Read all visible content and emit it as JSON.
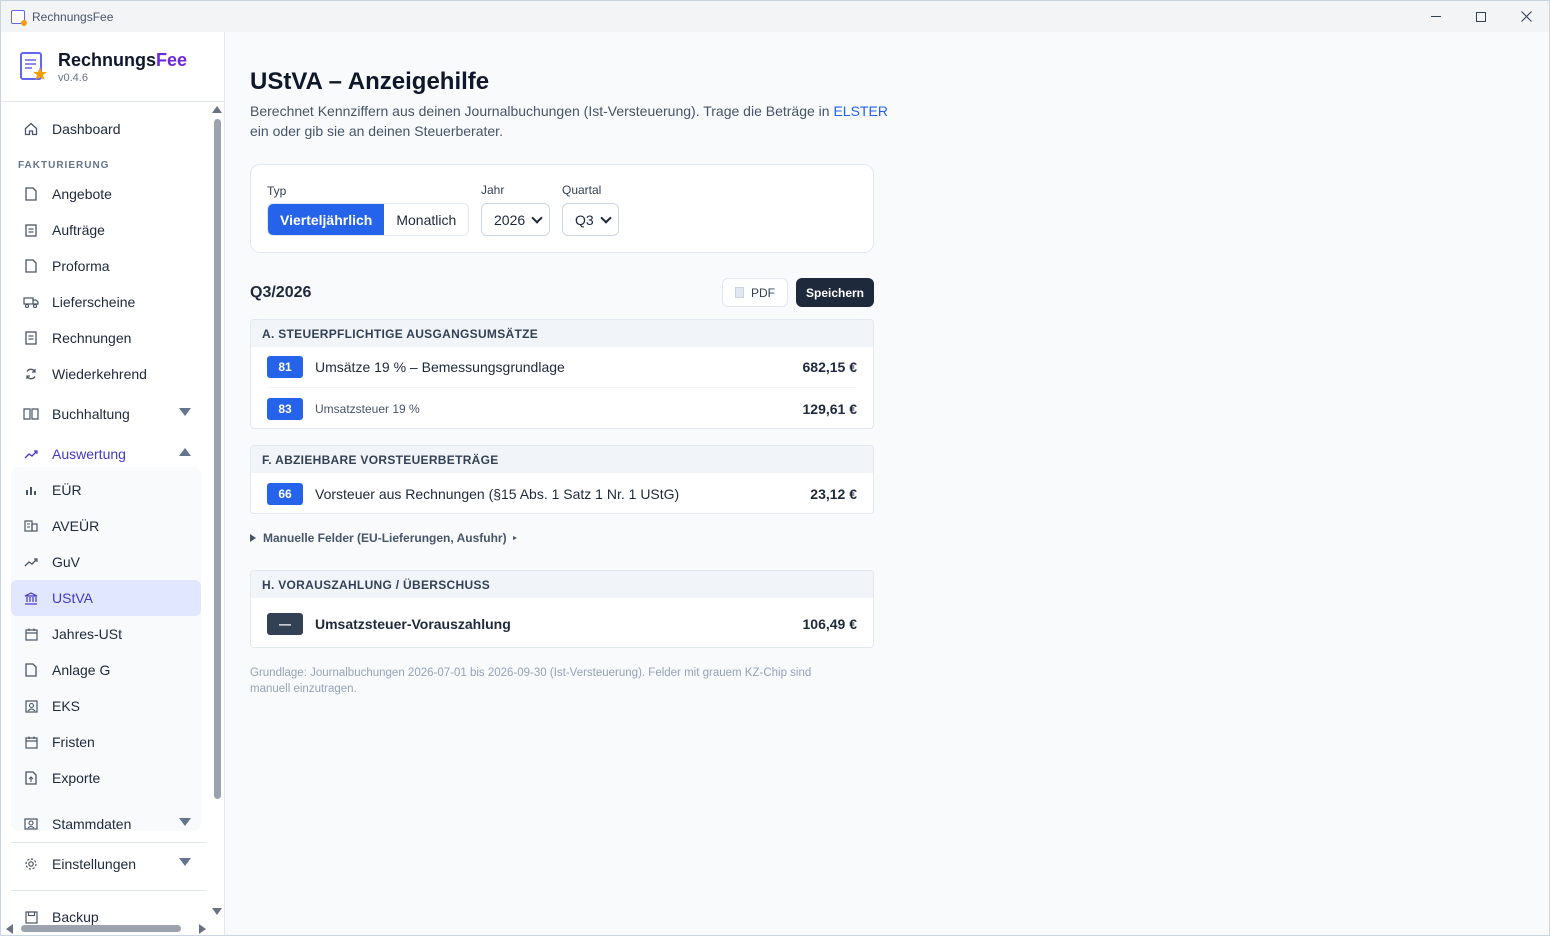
{
  "window": {
    "title": "RechnungsFee"
  },
  "brand": {
    "name_main": "Rechnungs",
    "name_accent": "Fee",
    "version": "v0.4.6"
  },
  "sidebar": {
    "dashboard": "Dashboard",
    "section_fakturierung": "FAKTURIERUNG",
    "items": {
      "angebote": "Angebote",
      "auftraege": "Aufträge",
      "proforma": "Proforma",
      "lieferscheine": "Lieferscheine",
      "rechnungen": "Rechnungen",
      "wiederkehrend": "Wiederkehrend",
      "buchhaltung": "Buchhaltung",
      "auswertung": "Auswertung",
      "euer": "EÜR",
      "aveuer": "AVEÜR",
      "guv": "GuV",
      "ustva": "UStVA",
      "jahres_ust": "Jahres-USt",
      "anlage_g": "Anlage G",
      "eks": "EKS",
      "fristen": "Fristen",
      "exporte": "Exporte",
      "stammdaten": "Stammdaten",
      "einstellungen": "Einstellungen",
      "backup": "Backup"
    }
  },
  "page": {
    "title": "UStVA – Anzeigehilfe",
    "desc_before": "Berechnet Kennziffern aus deinen Journalbuchungen (Ist-Versteuerung). Trage die Beträge in ",
    "desc_link": "ELSTER",
    "desc_after": " ein oder gib sie an deinen Steuerberater."
  },
  "filters": {
    "typ_label": "Typ",
    "typ_options": [
      "Vierteljährlich",
      "Monatlich"
    ],
    "typ_selected": "Vierteljährlich",
    "jahr_label": "Jahr",
    "jahr_value": "2026",
    "quartal_label": "Quartal",
    "quartal_value": "Q3"
  },
  "report": {
    "period": "Q3/2026",
    "pdf_label": "PDF",
    "save_label": "Speichern",
    "section_a": {
      "title": "A. STEUERPFLICHTIGE AUSGANGSUMSÄTZE",
      "rows": [
        {
          "kz": "81",
          "label": "Umsätze 19 % – Bemessungsgrundlage",
          "value": "682,15 €"
        },
        {
          "kz": "83",
          "label": "Umsatzsteuer 19 %",
          "value": "129,61 €"
        }
      ]
    },
    "section_f": {
      "title": "F. ABZIEHBARE VORSTEUERBETRÄGE",
      "rows": [
        {
          "kz": "66",
          "label": "Vorsteuer aus Rechnungen (§15 Abs. 1 Satz 1 Nr. 1 UStG)",
          "value": "23,12 €"
        }
      ]
    },
    "manual_toggle": "Manuelle Felder (EU-Lieferungen, Ausfuhr)",
    "section_h": {
      "title": "H. VORAUSZAHLUNG / ÜBERSCHUSS",
      "rows": [
        {
          "kz": "—",
          "label": "Umsatzsteuer-Vorauszahlung",
          "value": "106,49 €"
        }
      ]
    },
    "footnote": "Grundlage: Journalbuchungen 2026-07-01 bis 2026-09-30 (Ist-Versteuerung). Felder mit grauem KZ-Chip sind manuell einzutragen."
  },
  "colors": {
    "primary": "#2563eb",
    "accent": "#6d28d9",
    "active_bg": "#e0e7ff",
    "dark": "#1e293b"
  }
}
